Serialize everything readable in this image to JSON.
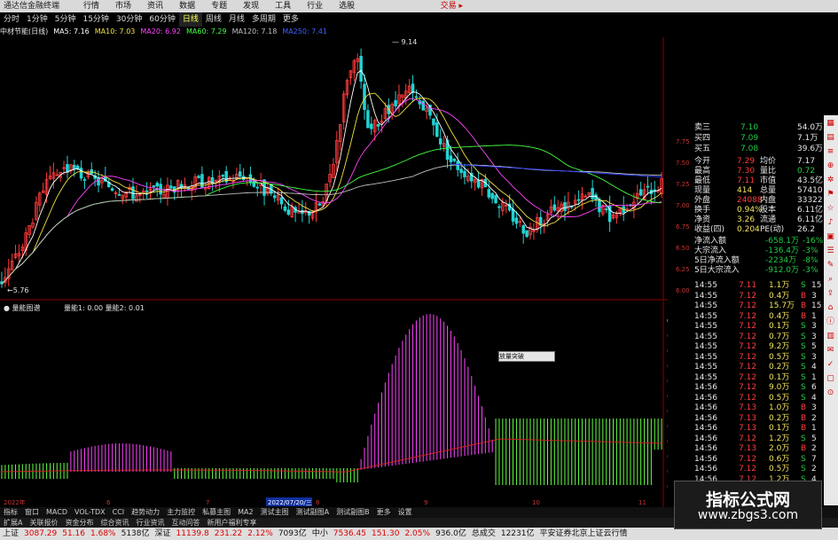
{
  "app": {
    "brand": "通达信金融终端",
    "menu": [
      "行情",
      "市场",
      "资讯",
      "数据",
      "专题",
      "发现",
      "工具",
      "行业",
      "选股"
    ],
    "trade_label": "交易 ▸"
  },
  "periods": [
    {
      "label": "分时",
      "active": false
    },
    {
      "label": "1分钟",
      "active": false
    },
    {
      "label": "5分钟",
      "active": false
    },
    {
      "label": "15分钟",
      "active": false
    },
    {
      "label": "30分钟",
      "active": false
    },
    {
      "label": "60分钟",
      "active": false
    },
    {
      "label": "日线",
      "active": true
    },
    {
      "label": "周线",
      "active": false
    },
    {
      "label": "月线",
      "active": false
    },
    {
      "label": "多周期",
      "active": false
    },
    {
      "label": "更多",
      "active": false
    }
  ],
  "ma_legend": {
    "title": "中材节能(日线)",
    "items": [
      {
        "text": "MA5: 7.16",
        "color": "#ffffff"
      },
      {
        "text": "MA10: 7.03",
        "color": "#f0e040"
      },
      {
        "text": "MA20: 6.92",
        "color": "#ff44ff"
      },
      {
        "text": "MA60: 7.29",
        "color": "#44ff44"
      },
      {
        "text": "MA120: 7.18",
        "color": "#c0c0c0"
      },
      {
        "text": "MA250: 7.41",
        "color": "#4060ff"
      }
    ]
  },
  "chart_data": {
    "type": "candlestick",
    "price_axis_ticks": [
      7.75,
      7.5,
      7.25,
      7.0,
      6.75,
      6.5,
      6.25,
      6.0
    ],
    "price_high_label": "9.14",
    "price_low_label": "5.76",
    "indicator_title": "量能图谱",
    "indicator_items": [
      "量能1: 0.00",
      "量能2: 0.01"
    ],
    "indicator_axis_ticks": [
      "0.03",
      "0.03",
      "0.02",
      "0.02",
      "0.02",
      "0.02",
      "0.02",
      "0.01",
      "0.01",
      "0.01",
      "0.01",
      "0.00"
    ],
    "date_label": "2022/07/20/三",
    "axis_labels": [
      "2022年",
      "6",
      "7",
      "8",
      "9",
      "10",
      "11"
    ],
    "tooltip": "放量突破"
  },
  "quote_panel": {
    "rows_top": [
      {
        "label": "卖三",
        "value": "7.10",
        "vol": "54.0万"
      },
      {
        "label": "买四",
        "value": "7.09",
        "vol": "7.1万"
      },
      {
        "label": "买五",
        "value": "7.08",
        "vol": "39.6万"
      }
    ],
    "stats": [
      {
        "l1": "今开",
        "v1": "7.29",
        "l2": "均价",
        "v2": "7.17"
      },
      {
        "l1": "最高",
        "v1": "7.30",
        "l2": "量比",
        "v2": "0.72"
      },
      {
        "l1": "最低",
        "v1": "7.11",
        "l2": "市值",
        "v2": "43.5亿"
      },
      {
        "l1": "现量",
        "v1": "414",
        "l2": "总量",
        "v2": "57410"
      },
      {
        "l1": "外盘",
        "v1": "24088",
        "l2": "内盘",
        "v2": "33322"
      },
      {
        "l1": "换手",
        "v1": "0.94%",
        "l2": "股本",
        "v2": "6.11亿"
      },
      {
        "l1": "净资",
        "v1": "3.26",
        "l2": "流通",
        "v2": "6.11亿"
      },
      {
        "l1": "收益(四)",
        "v1": "0.204",
        "l2": "PE(动)",
        "v2": "26.2"
      }
    ],
    "flows": [
      {
        "label": "净流入额",
        "value": "-658.1万",
        "pct": "-16%"
      },
      {
        "label": "大宗流入",
        "value": "-136.4万",
        "pct": "-3%"
      },
      {
        "label": "5日净流入额",
        "value": "-2234万",
        "pct": "-8%"
      },
      {
        "label": "5日大宗流入",
        "value": "-912.0万",
        "pct": "-3%"
      }
    ],
    "ticks": [
      {
        "t": "14:55",
        "p": "7.11",
        "v": "1.1万",
        "d": "S",
        "n": "15"
      },
      {
        "t": "14:55",
        "p": "7.12",
        "v": "0.4万",
        "d": "B",
        "n": "3"
      },
      {
        "t": "14:55",
        "p": "7.12",
        "v": "15.7万",
        "d": "B",
        "n": "15"
      },
      {
        "t": "14:55",
        "p": "7.12",
        "v": "0.4万",
        "d": "B",
        "n": "1"
      },
      {
        "t": "14:55",
        "p": "7.12",
        "v": "0.1万",
        "d": "S",
        "n": "3"
      },
      {
        "t": "14:55",
        "p": "7.12",
        "v": "0.7万",
        "d": "S",
        "n": "3"
      },
      {
        "t": "14:55",
        "p": "7.12",
        "v": "9.2万",
        "d": "S",
        "n": "5"
      },
      {
        "t": "14:55",
        "p": "7.12",
        "v": "0.5万",
        "d": "S",
        "n": "3"
      },
      {
        "t": "14:55",
        "p": "7.12",
        "v": "0.2万",
        "d": "S",
        "n": "4"
      },
      {
        "t": "14:55",
        "p": "7.12",
        "v": "0.1万",
        "d": "S",
        "n": "1"
      },
      {
        "t": "14:56",
        "p": "7.12",
        "v": "9.0万",
        "d": "S",
        "n": "6"
      },
      {
        "t": "14:56",
        "p": "7.12",
        "v": "0.5万",
        "d": "S",
        "n": "4"
      },
      {
        "t": "14:56",
        "p": "7.13",
        "v": "1.0万",
        "d": "B",
        "n": "3"
      },
      {
        "t": "14:56",
        "p": "7.13",
        "v": "0.2万",
        "d": "B",
        "n": "2"
      },
      {
        "t": "14:56",
        "p": "7.13",
        "v": "0.1万",
        "d": "B",
        "n": "1"
      },
      {
        "t": "14:56",
        "p": "7.12",
        "v": "1.2万",
        "d": "S",
        "n": "5"
      },
      {
        "t": "14:56",
        "p": "7.13",
        "v": "2.0万",
        "d": "B",
        "n": "2"
      },
      {
        "t": "14:56",
        "p": "7.12",
        "v": "0.6万",
        "d": "S",
        "n": "7"
      },
      {
        "t": "14:56",
        "p": "7.12",
        "v": "0.5万",
        "d": "S",
        "n": "2"
      },
      {
        "t": "14:56",
        "p": "7.12",
        "v": "1.2万",
        "d": "S",
        "n": "4"
      }
    ]
  },
  "tabs_row1": [
    "指标",
    "窗口",
    "MACD",
    "VOL-TDX",
    "CCI",
    "趋势动力",
    "主力监控",
    "私募主图",
    "MA2",
    "测试主图",
    "测试副图A",
    "测试副图B",
    "更多",
    "设置"
  ],
  "tabs_row2": [
    "扩展A",
    "关联报价",
    "资金分布",
    "综合资讯",
    "行业资讯",
    "互动问答",
    "新用户福利专享"
  ],
  "status": [
    {
      "text": "上证",
      "cls": ""
    },
    {
      "text": "3087.29",
      "cls": "r"
    },
    {
      "text": "51.16",
      "cls": "r"
    },
    {
      "text": "1.68%",
      "cls": "r"
    },
    {
      "text": "5138亿",
      "cls": ""
    },
    {
      "text": "深证",
      "cls": ""
    },
    {
      "text": "11139.8",
      "cls": "r"
    },
    {
      "text": "231.22",
      "cls": "r"
    },
    {
      "text": "2.12%",
      "cls": "r"
    },
    {
      "text": "7093亿",
      "cls": ""
    },
    {
      "text": "中小",
      "cls": ""
    },
    {
      "text": "7536.45",
      "cls": "r"
    },
    {
      "text": "151.30",
      "cls": "r"
    },
    {
      "text": "2.05%",
      "cls": "r"
    },
    {
      "text": "936.0亿",
      "cls": ""
    },
    {
      "text": "总成交",
      "cls": ""
    },
    {
      "text": "12231亿",
      "cls": ""
    },
    {
      "text": "平安证券北京上证云行情",
      "cls": ""
    }
  ],
  "watermark": {
    "line1": "指标公式网",
    "line2": "www.zbgs3.com"
  }
}
